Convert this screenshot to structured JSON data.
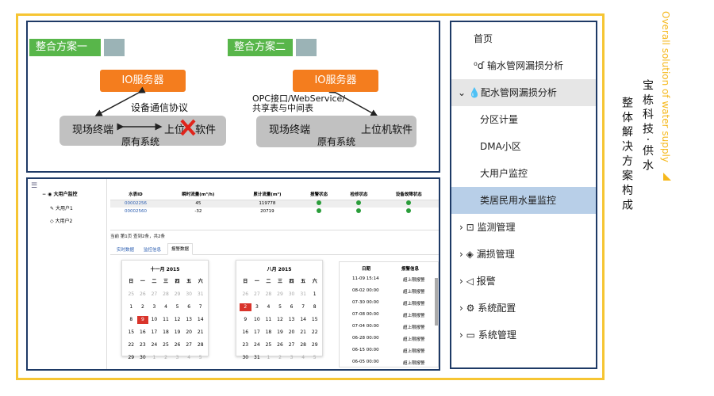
{
  "diagram1": {
    "tag": "整合方案一",
    "io": "IO服务器",
    "protocol": "设备通信协议",
    "field": "现场终端",
    "upper": "上位机软件",
    "upper_visible": "上位",
    "upper_rest": "软件",
    "origin": "原有系统"
  },
  "diagram2": {
    "tag": "整合方案二",
    "io": "IO服务器",
    "protocol_l1": "OPC接口/WebService/",
    "protocol_l2": "共享表与中间表",
    "field": "现场终端",
    "upper": "上位机软件",
    "origin": "原有系统"
  },
  "tree": {
    "root": "大用户监控",
    "items": [
      "大用户1",
      "大用户2"
    ]
  },
  "table": {
    "headers": [
      "水表ID",
      "瞬时流量(m³/h)",
      "累计流量(m³)",
      "报警状态",
      "检修状态",
      "设备故障状态"
    ],
    "rows": [
      [
        "00002256",
        "45",
        "119778"
      ],
      [
        "00002560",
        "-32",
        "20719"
      ]
    ]
  },
  "paging": "当前 第1页 查到2条，共2条",
  "tabs": [
    "实时数据",
    "监控信息",
    "报警数据"
  ],
  "cal1": {
    "title": "十一月 2015",
    "selected": "9"
  },
  "cal2": {
    "title": "八月 2015",
    "selected": "2"
  },
  "weekdays": [
    "日",
    "一",
    "二",
    "三",
    "四",
    "五",
    "六"
  ],
  "alarm": {
    "headers": [
      "日期",
      "报警信息"
    ],
    "dates": [
      "11-09 15:14",
      "08-02 00:00",
      "07-30 00:00",
      "07-08 00:00",
      "07-04 00:00",
      "06-28 00:00",
      "06-15 00:00",
      "06-05 00:00"
    ],
    "msg": "超上限报警"
  },
  "menu": {
    "home": "首页",
    "items": [
      "输水管网漏损分析",
      "配水管网漏损分析",
      "分区计量",
      "DMA小区",
      "大用户监控",
      "类居民用水量监控",
      "监测管理",
      "漏损管理",
      "报警",
      "系统配置",
      "系统管理"
    ]
  },
  "side": {
    "en": "Overall solution of water supply",
    "cn1": "宝 栋 科 技 · 供 水",
    "cn2": "整 体 解 决 方 案 构 成"
  }
}
